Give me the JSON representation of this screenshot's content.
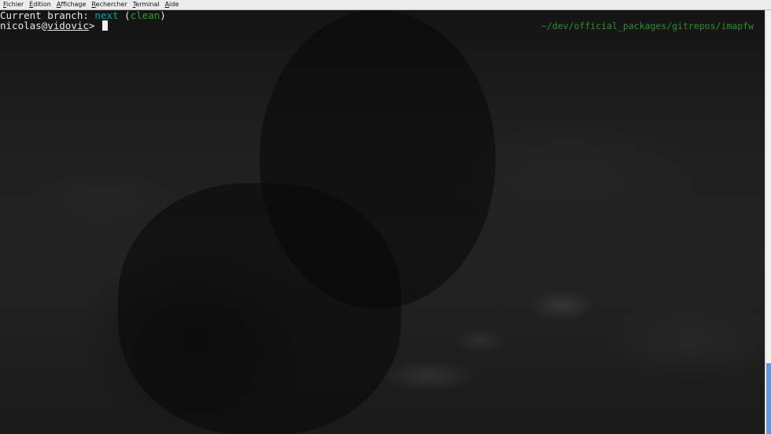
{
  "menubar": {
    "items": [
      {
        "mnemonic": "F",
        "rest": "ichier"
      },
      {
        "mnemonic": "É",
        "rest": "dition"
      },
      {
        "mnemonic": "A",
        "rest": "ffichage"
      },
      {
        "mnemonic": "R",
        "rest": "echercher"
      },
      {
        "mnemonic": "T",
        "rest": "erminal"
      },
      {
        "mnemonic": "A",
        "rest": "ide"
      }
    ]
  },
  "terminal": {
    "branch_prefix": "Current branch: ",
    "branch_name": "next",
    "paren_open": " (",
    "branch_status": "clean",
    "paren_close": ")",
    "prompt_user": "nicolas@",
    "prompt_host": "vidovic",
    "prompt_symbol": "> ",
    "cwd": "~/dev/official_packages/gitrepos/imapfw"
  },
  "colors": {
    "branch_name": "#00a0a0",
    "branch_status": "#2e9a2e",
    "cwd": "#2e8f2e",
    "text": "#e6e6e6",
    "scroll_thumb": "#6a96d8"
  }
}
